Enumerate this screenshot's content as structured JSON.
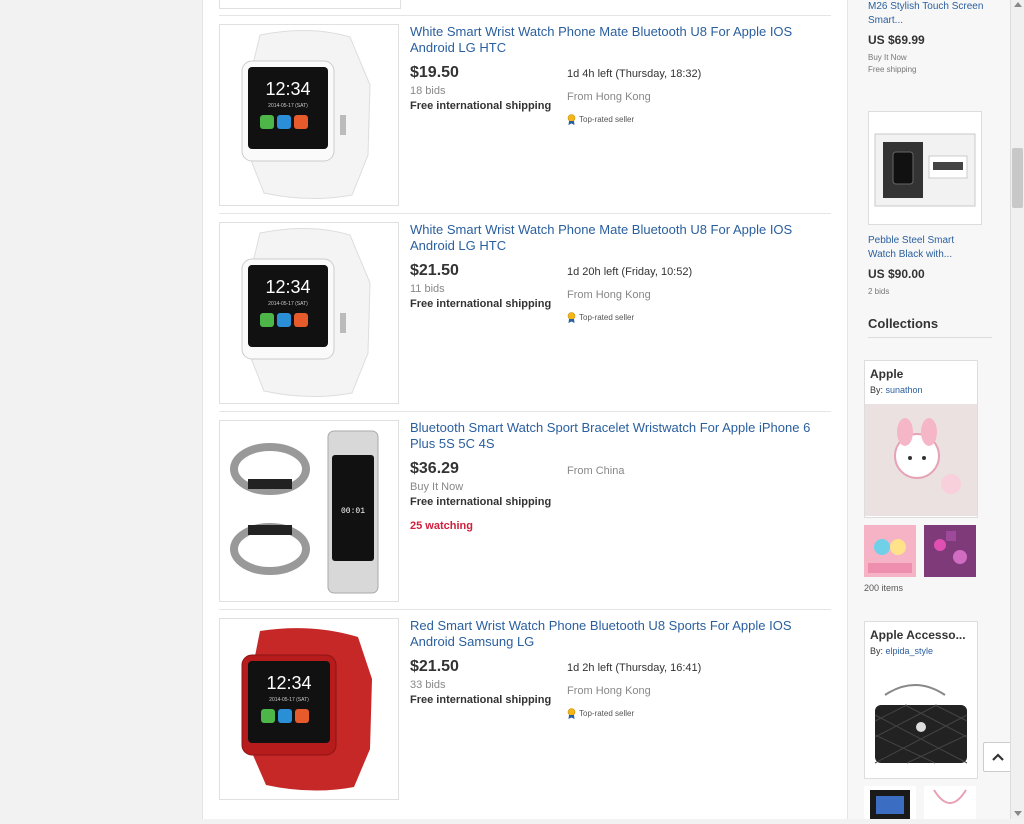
{
  "listings": [
    {
      "title": "White Smart Wrist Watch Phone Mate Bluetooth U8 For Apple IOS Android LG HTC",
      "price": "$19.50",
      "sub": "18 bids",
      "shipping": "Free international shipping",
      "time_left": "1d 4h left (Thursday, 18:32)",
      "location": "From Hong Kong",
      "badge": "Top-rated seller",
      "watching": "",
      "watch_face_time": "12:34",
      "watch_face_date": "2014-05-17 (SAT)"
    },
    {
      "title": "White Smart Wrist Watch Phone Mate Bluetooth U8 For Apple IOS Android LG HTC",
      "price": "$21.50",
      "sub": "11 bids",
      "shipping": "Free international shipping",
      "time_left": "1d 20h left (Friday, 10:52)",
      "location": "From Hong Kong",
      "badge": "Top-rated seller",
      "watching": "",
      "watch_face_time": "12:34",
      "watch_face_date": "2014-05-17 (SAT)"
    },
    {
      "title": "Bluetooth Smart Watch Sport Bracelet Wristwatch For Apple iPhone 6 Plus 5S 5C 4S",
      "price": "$36.29",
      "sub": "Buy It Now",
      "shipping": "Free international shipping",
      "time_left": "",
      "location": "From China",
      "badge": "",
      "watching": "25 watching",
      "watch_face_time": "00:01",
      "watch_face_date": ""
    },
    {
      "title": "Red Smart Wrist Watch Phone Bluetooth U8 Sports For Apple IOS Android Samsung LG",
      "price": "$21.50",
      "sub": "33 bids",
      "shipping": "Free international shipping",
      "time_left": "1d 2h left (Thursday, 16:41)",
      "location": "From Hong Kong",
      "badge": "Top-rated seller",
      "watching": "",
      "watch_face_time": "12:34",
      "watch_face_date": "2014-05-17 (SAT)"
    }
  ],
  "rail": {
    "item1": {
      "title_line1": "M26 Stylish Touch Screen",
      "title_line2": "Smart...",
      "price": "US $69.99",
      "sub1": "Buy It Now",
      "sub2": "Free shipping"
    },
    "item2": {
      "title_line1": "Pebble Steel Smart",
      "title_line2": "Watch Black with...",
      "price": "US $90.00",
      "sub1": "2 bids"
    },
    "collections_heading": "Collections",
    "collection1": {
      "title": "Apple",
      "by_label": "By:",
      "by_user": "sunathon",
      "count": "200 items"
    },
    "collection2": {
      "title": "Apple Accesso...",
      "by_label": "By:",
      "by_user": "elpida_style"
    }
  },
  "colors": {
    "link": "#2a5f9e",
    "watching": "#d01f3c",
    "price": "#333333"
  }
}
